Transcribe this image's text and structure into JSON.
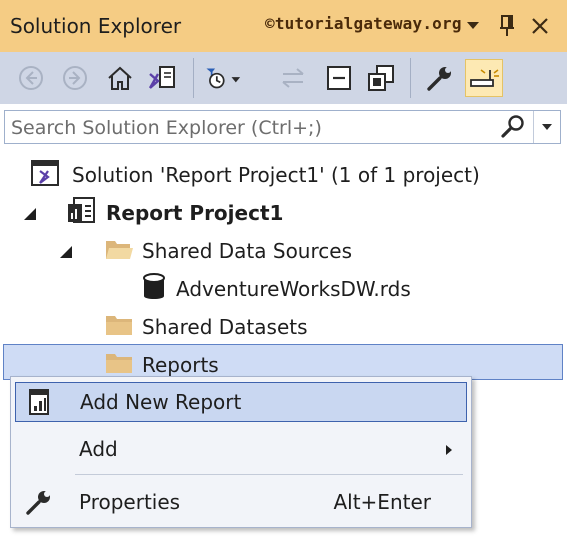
{
  "titlebar": {
    "title": "Solution Explorer",
    "watermark": "©tutorialgateway.org",
    "dropdown_icon": "chevron-down-icon",
    "pin_icon": "pin-icon",
    "close_icon": "close-icon"
  },
  "toolbar": {
    "items": [
      "back-icon",
      "forward-icon",
      "home-icon",
      "switch-views-icon",
      "pending-changes-filter-icon",
      "sync-icon",
      "collapse-all-icon",
      "show-all-files-icon",
      "properties-icon",
      "preview-selected-items-icon"
    ]
  },
  "search": {
    "placeholder": "Search Solution Explorer (Ctrl+;)",
    "value": ""
  },
  "tree": {
    "solution": "Solution 'Report Project1' (1 of 1 project)",
    "project": "Report Project1",
    "shared_data_sources": "Shared Data Sources",
    "data_source_file": "AdventureWorksDW.rds",
    "shared_datasets": "Shared Datasets",
    "reports": "Reports"
  },
  "context_menu": {
    "add_new_report": "Add New Report",
    "add": "Add",
    "properties": "Properties",
    "properties_shortcut": "Alt+Enter"
  },
  "colors": {
    "titlebar_bg": "#f5cc84",
    "toolbar_bg": "#cfd6e5",
    "selection_bg": "#cfdcf5",
    "selection_border": "#5f82c6",
    "folder": "#dcb67a"
  }
}
